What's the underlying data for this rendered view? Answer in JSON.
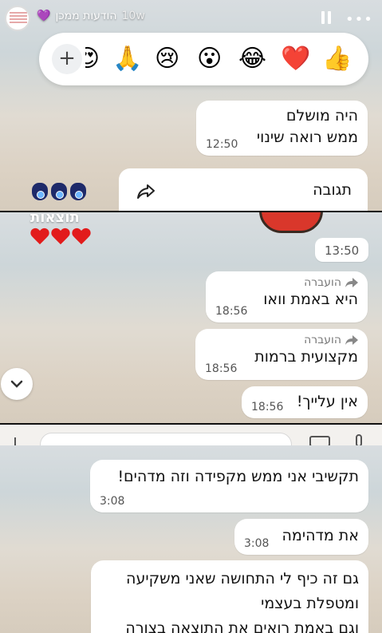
{
  "header": {
    "name": "הודעות ממכן",
    "age": "10w"
  },
  "reactions": {
    "emojis": [
      "👍",
      "❤️",
      "😂",
      "😮",
      "😢",
      "🙏",
      "😍"
    ],
    "plus": "+"
  },
  "messages_top": [
    {
      "lines": [
        "היה מושלם",
        "ממש רואה שינוי"
      ],
      "time": "12:50"
    }
  ],
  "reply_label": "תגובה",
  "panel2": {
    "results_label": "תוצאות",
    "hearts": [
      "❤️",
      "❤️",
      "❤️"
    ],
    "lone_time": "13:50",
    "messages": [
      {
        "forwarded": "הועברה",
        "text": "היא באמת וואו",
        "time": "18:56"
      },
      {
        "forwarded": "הועברה",
        "text": "מקצועית ברמות",
        "time": "18:56"
      },
      {
        "text": "אין עלייך!",
        "time": "18:56"
      }
    ]
  },
  "panel4": {
    "messages": [
      {
        "text": "תקשיבי אני ממש מקפידה וזה מדהים!",
        "time": "3:08"
      },
      {
        "text": "את מדהימה",
        "time": "3:08"
      },
      {
        "lines": [
          "גם זה כיף לי התחושה שאני משקיעה",
          "ומטפלת בעצמי",
          "וגם באמת רואים את התוצאה בצורה"
        ]
      }
    ]
  },
  "colors": {
    "bubble": "#ffffff",
    "heart": "#e21b1b"
  }
}
